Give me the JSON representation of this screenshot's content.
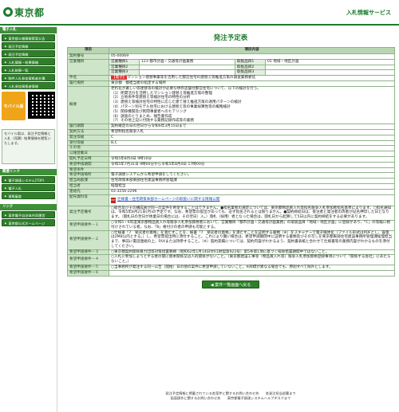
{
  "header": {
    "logo_text": "東京都",
    "system_title": "入札情報サービス"
  },
  "sidebar": {
    "sections": [
      {
        "label": "電子入札",
        "items": [
          "東京都公報情報第案公告",
          "発注予定情報",
          "発注予定情報",
          "入札情報・結果情報",
          "入札結果一覧",
          "物件入札参加資格者名簿",
          "入札参加資格者情報"
        ]
      }
    ],
    "mobile_badge": "モバイル版",
    "mobile_note": "モバイル版は、発注予定情報と入札（見積）結果情報を閲覧いたします。",
    "links_head": "関連リンク",
    "links": [
      "電子調達システム(TOP)",
      "電子入札",
      "資格審査"
    ],
    "links2_head": "リンク",
    "links2": [
      "東京電子自治体共同運営",
      "東京都公式ホームページ"
    ]
  },
  "page": {
    "title": "発注予定表",
    "col_item": "項目",
    "col_content": "項目内容"
  },
  "rows": {
    "contract_no_label": "契約番号",
    "contract_no": "05-00069",
    "biz_type_label": "営業種目",
    "biz1_label": "営業種目1",
    "biz1": "123 都市計画・交通等計画業務",
    "biz2_label": "営業種目2",
    "biz3_label": "営業種目3",
    "cls1_label": "取扱品目1",
    "cls1": "01 地域・地区計画",
    "cls2_label": "取扱品目2",
    "cls3_label": "取扱品目3",
    "subject_label": "件名",
    "subject_tag": "【電子】",
    "subject": "マンション建替事業等を活用した都営住宅の建替え等推進方策の調査業務委託",
    "place_label": "履行場所",
    "place": "東京都　都担当者の指定する場所",
    "summary_label": "概要",
    "summary": [
      "老朽化が著しい等建替等の検討が必要な併存店舗付都営住宅について、以下の検討を行う。",
      "（1）民間活力を活用したマンション建替え等推進方策の整理",
      "（2）立地条件等建替え等検討住宅の特性の分析",
      "（3）建替え等検討住宅の特性に応じた建て替え推進方策の適用パターンの検討",
      "（4）パターン別モデル住宅における建替え等の事業採算性等の概略検討",
      "（5）関係機関及び民間事業者へのヒアリング",
      "（6）調査のとりまとめ、報告書作成",
      "（7）その他上記に付随する業務記録作成等の業務"
    ],
    "period_label": "履行期間",
    "period": "契約確定の日の翌日から令和6年3月15日まで",
    "method_label": "契約方法",
    "method": "希望制指名競争入札",
    "grade_label": "発注等級",
    "grade": "C",
    "recv_grade_label": "受付等級",
    "recv_grade": "B,C",
    "other_label": "その他",
    "notice_date_label": "公報登載日",
    "open_date_label": "開札予定日時",
    "open_date": "令和5年8月4日 9時10分",
    "apply_period_label": "希望申請期間",
    "apply_period": "令和5年7月31日 9時00分から令和5年8月4日 17時00分",
    "apply_cond_label": "希望条件",
    "apply_place_label": "希望申請場所",
    "apply_place": "電子調達システムから希望申請をしてください。",
    "dept_label": "担当局部課",
    "dept": "住宅政策本部東部住宅建設事務所管理課",
    "person_label": "担当者",
    "person": "経理担当",
    "tel_label": "連絡先",
    "tel": "03-3256-2296",
    "docs_label": "配布資料等",
    "doc_link": "仕様書・住宅政策本部ホームページの取扱いに関する情報公開",
    "notes_label": "発注予定備考",
    "notes": "○総合及びその構成員が同一の案件を希望することはできません。●指名業者の選定については、東京都物品買入れ等指名競争入札参加者指名基準によります。○指名通知は、令和5年8月21日(月)の予定です。なお、希望票の提出があっても、必ず指名されるとは限りません。●契約締結日は、受注者と発注者の両者が記名押印した日となります。（開札日の翌日が休業日の場合には、その翌日）入。）落札（採用）者となった場合は、開札日から起算して5日以内に契約締結をする必要があります。",
    "req1_label": "希望申請要件－１",
    "req1": "○令和5・6年度東京都物品買入れ等競争入札参加資格者において、営業種目「都市計画・交通等計画業務」の取扱品目「地域・地区計画」に登録があり、「C」の等級に格付けされている者。なお、「B」格付けの者の申請も可能とする。",
    "req2_label": "希望申請要件－２",
    "req2": "○仕様書「7　受託者の資格」を満たすことを、様書「7　受託者の資格」を満たすことを証明する書類（※）をスキャナーで電子媒体化（ファイル形式はPDFとし、容量は2MB以内とする。）し、希望票提出時に添付すること。これにより難い場合は、希望申請期間中に証明する書類及びその写しを東京都東部住宅建設事務所管理課経理担当まで、事前に電話連絡の上、FAXまたは持参すること。（※）契約実績については、契約内容がわかるよう、契約書表紙と合わせて仕様書等の業務内容がわかるものを添付してください。",
    "req3_label": "希望申請要件－３",
    "req3": "○東京都契約関係暴力団等対策措置要綱（昭和62年1月14日付61財契第922号）第5条第1項に基づく排除措置期間中ではないこと。",
    "req4_label": "希望申請要件－４",
    "req4": "○入札に参加しようとする者の間に資本関係又は人的関係がないこと。（東京都建設工事等（物品買入れ等）競争入札参加資格登録事項について「関係する会社」にあたらないこと。）",
    "req5_label": "希望申請要件－５",
    "req5": "○当事務所が発注する同一公告（開始）日の他の案件に希望申請していないこと。※商標が異なる場合でも、原則すべて除外とします。",
    "req6_label": "希望申請要件－６"
  },
  "back_button": "案件一覧画面へ戻る",
  "footer": {
    "line1": "発注予定情報に掲載されている各案件に関するお問い合わせ先　　各発注担当部署まで",
    "line2": "画面操作に関するお問い合わせ先　　東京都電子調達システムヘルプデスクまで"
  }
}
